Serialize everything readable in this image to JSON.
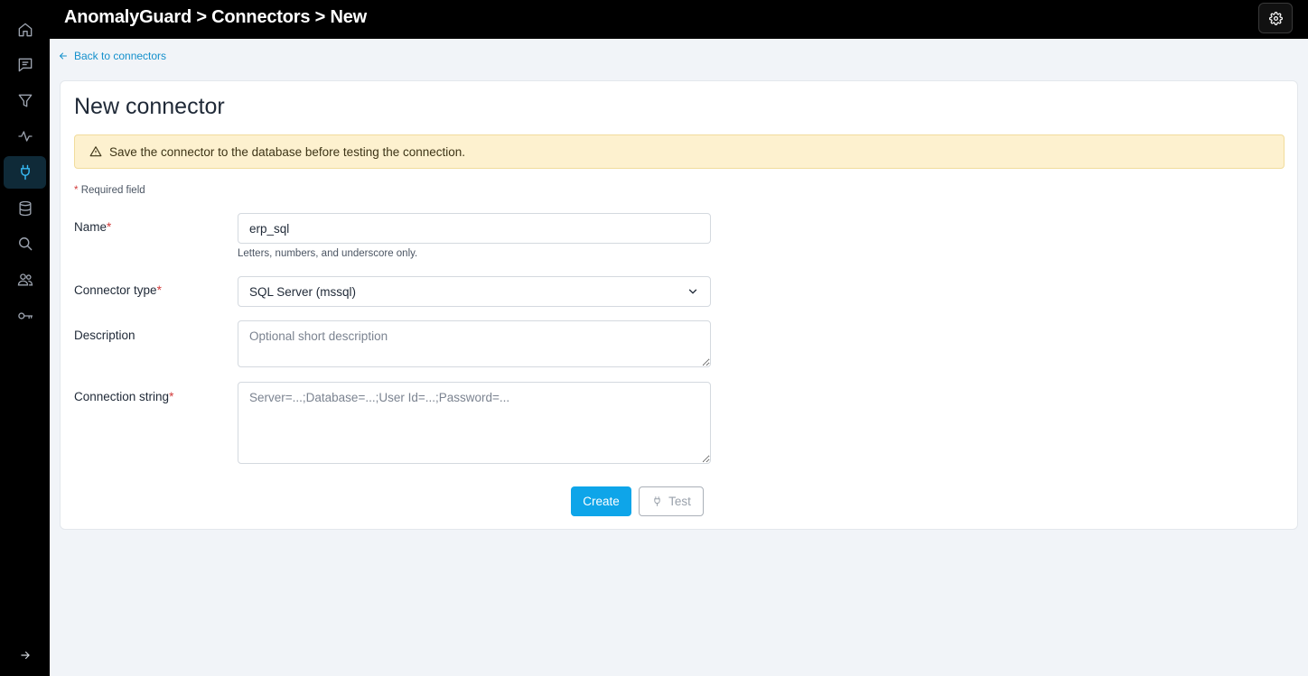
{
  "topbar": {
    "breadcrumb": "AnomalyGuard > Connectors > New"
  },
  "sidebar": {
    "items": [
      {
        "icon": "home-icon",
        "active": false
      },
      {
        "icon": "chat-icon",
        "active": false
      },
      {
        "icon": "filter-icon",
        "active": false
      },
      {
        "icon": "activity-icon",
        "active": false
      },
      {
        "icon": "plug-icon",
        "active": true
      },
      {
        "icon": "database-icon",
        "active": false
      },
      {
        "icon": "search-icon",
        "active": false
      },
      {
        "icon": "users-icon",
        "active": false
      },
      {
        "icon": "key-icon",
        "active": false
      }
    ],
    "collapse_icon": "arrow-right-icon"
  },
  "back_link": "Back to connectors",
  "page_title": "New connector",
  "alert": {
    "icon": "warning-icon",
    "text": "Save the connector to the database before testing the connection."
  },
  "required_note": {
    "star": "*",
    "text": "Required field"
  },
  "form": {
    "name": {
      "label": "Name",
      "star": "*",
      "value": "erp_sql",
      "hint": "Letters, numbers, and underscore only."
    },
    "connector_type": {
      "label": "Connector type",
      "star": "*",
      "value": "SQL Server (mssql)"
    },
    "description": {
      "label": "Description",
      "placeholder": "Optional short description"
    },
    "connection_string": {
      "label": "Connection string",
      "star": "*",
      "placeholder": "Server=...;Database=...;User Id=...;Password=..."
    }
  },
  "buttons": {
    "create": "Create",
    "test": "Test"
  },
  "colors": {
    "accent": "#0ea5e9",
    "link": "#1490cc",
    "alert_bg": "#fdf1cf",
    "required": "#d23b3b"
  }
}
